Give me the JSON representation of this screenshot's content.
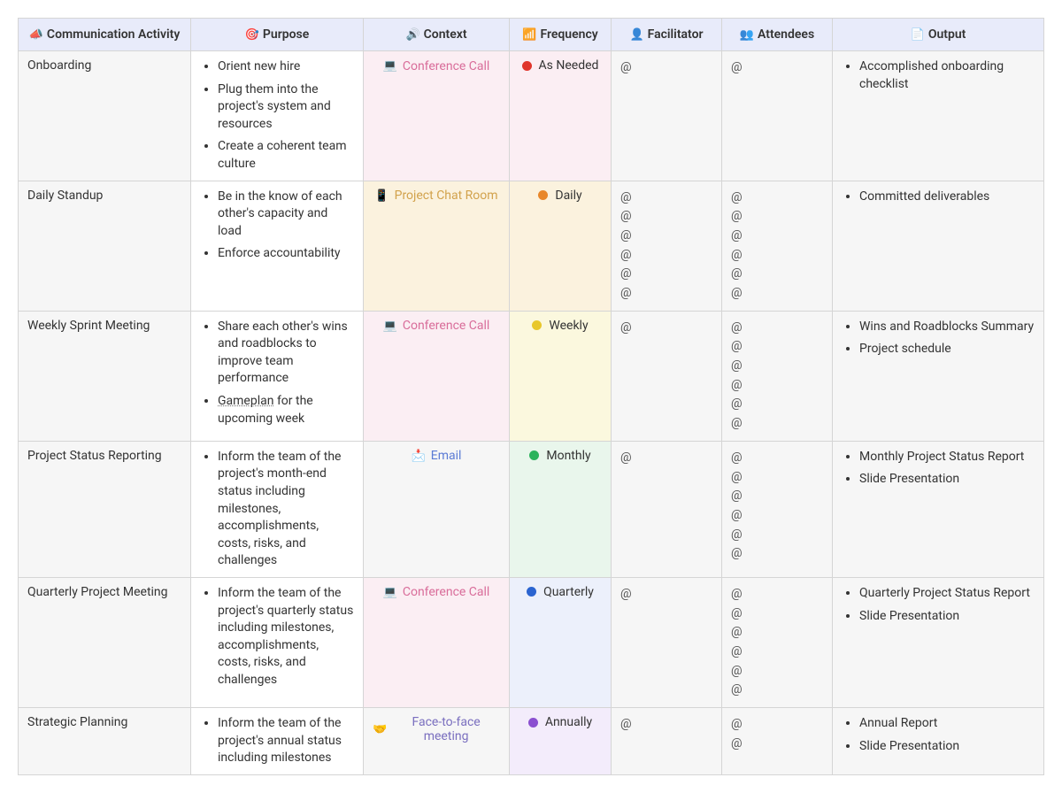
{
  "headers": {
    "activity": "Communication Activity",
    "purpose": "Purpose",
    "context": "Context",
    "frequency": "Frequency",
    "facilitator": "Facilitator",
    "attendees": "Attendees",
    "output": "Output"
  },
  "header_icons": {
    "activity": "📣",
    "purpose": "🎯",
    "context": "🔊",
    "frequency": "📶",
    "facilitator": "👤",
    "attendees": "👥",
    "output": "📄"
  },
  "contexts": {
    "conference": {
      "label": "Conference Call",
      "icon": "💻",
      "bg": "bg-conference",
      "cls": "ctx-conference"
    },
    "chatroom": {
      "label": "Project Chat Room",
      "icon": "📱",
      "bg": "bg-chatroom",
      "cls": "ctx-chatroom"
    },
    "email": {
      "label": "Email",
      "icon": "📩",
      "bg": "bg-email",
      "cls": "ctx-email"
    },
    "face": {
      "label": "Face-to-face meeting",
      "icon": "🤝",
      "bg": "bg-face",
      "cls": "ctx-face"
    }
  },
  "frequencies": {
    "asneeded": {
      "label": "As Needed",
      "color": "#e0352b",
      "bg": "bg-asneeded"
    },
    "daily": {
      "label": "Daily",
      "color": "#e8872b",
      "bg": "bg-daily"
    },
    "weekly": {
      "label": "Weekly",
      "color": "#e8c72b",
      "bg": "bg-weekly"
    },
    "monthly": {
      "label": "Monthly",
      "color": "#2bb35c",
      "bg": "bg-monthly"
    },
    "quarterly": {
      "label": "Quarterly",
      "color": "#2b64d0",
      "bg": "bg-quarterly"
    },
    "annually": {
      "label": "Annually",
      "color": "#8a4fd0",
      "bg": "bg-annually"
    }
  },
  "rows": [
    {
      "activity": "Onboarding",
      "purpose": [
        "Orient new hire",
        "Plug them into the project's system and resources",
        "Create a coherent team culture"
      ],
      "context": "conference",
      "frequency": "asneeded",
      "facilitator_count": 1,
      "attendee_count": 1,
      "output": [
        "Accomplished onboarding checklist"
      ]
    },
    {
      "activity": "Daily Standup",
      "purpose": [
        "Be in the know of each other's capacity and load",
        "Enforce accountability"
      ],
      "context": "chatroom",
      "frequency": "daily",
      "facilitator_count": 6,
      "attendee_count": 6,
      "output": [
        "Committed deliverables"
      ]
    },
    {
      "activity": "Weekly Sprint Meeting",
      "purpose": [
        "Share each other's wins and roadblocks to improve team performance",
        "{u}Gameplan{/u} for the upcoming week"
      ],
      "context": "conference",
      "frequency": "weekly",
      "facilitator_count": 1,
      "attendee_count": 6,
      "output": [
        "Wins and Roadblocks Summary",
        "Project schedule"
      ]
    },
    {
      "activity": "Project Status Reporting",
      "purpose": [
        "Inform the team of the project's month-end status including milestones, accomplishments, costs, risks, and challenges"
      ],
      "context": "email",
      "frequency": "monthly",
      "facilitator_count": 1,
      "attendee_count": 6,
      "output": [
        "Monthly Project Status Report",
        "Slide Presentation"
      ]
    },
    {
      "activity": "Quarterly Project Meeting",
      "purpose": [
        "Inform the team of the project's quarterly status including milestones, accomplishments, costs, risks, and challenges"
      ],
      "context": "conference",
      "frequency": "quarterly",
      "facilitator_count": 1,
      "attendee_count": 6,
      "output": [
        "Quarterly Project Status Report",
        "Slide Presentation"
      ]
    },
    {
      "activity": "Strategic Planning",
      "purpose": [
        "Inform the team of the project's annual status including milestones"
      ],
      "context": "face",
      "frequency": "annually",
      "facilitator_count": 1,
      "attendee_count": 2,
      "output": [
        "Annual Report",
        "Slide Presentation"
      ],
      "truncated": true
    }
  ]
}
